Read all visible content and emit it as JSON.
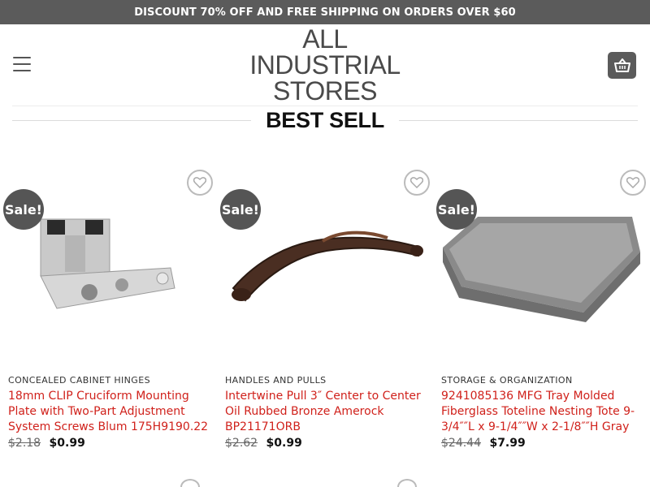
{
  "promo_banner": "DISCOUNT 70% OFF AND FREE SHIPPING ON ORDERS OVER $60",
  "logo": {
    "line1": "ALL",
    "line2": "INDUSTRIAL",
    "line3": "STORES"
  },
  "icons": {
    "menu": "hamburger-menu-icon",
    "cart": "shopping-basket-icon",
    "wishlist": "heart-icon"
  },
  "colors": {
    "banner": "#5b5b5b",
    "product_title": "#d0211b",
    "badge": "#555555"
  },
  "section_title": "BEST SELL",
  "products": [
    {
      "badge": "Sale!",
      "category": "CONCEALED CABINET HINGES",
      "title": "18mm CLIP Cruciform Mounting Plate with Two-Part Adjustment System Screws Blum 175H9190.22",
      "old_price": "$2.18",
      "price": "$0.99"
    },
    {
      "badge": "Sale!",
      "category": "HANDLES AND PULLS",
      "title": "Intertwine Pull 3″ Center to Center Oil Rubbed Bronze Amerock BP21171ORB",
      "old_price": "$2.62",
      "price": "$0.99"
    },
    {
      "badge": "Sale!",
      "category": "STORAGE & ORGANIZATION",
      "title": "9241085136 MFG Tray Molded Fiberglass Toteline Nesting Tote 9-3/4″″L x 9-1/4″″W x 2-1/8″″H Gray",
      "old_price": "$24.44",
      "price": "$7.99"
    }
  ]
}
